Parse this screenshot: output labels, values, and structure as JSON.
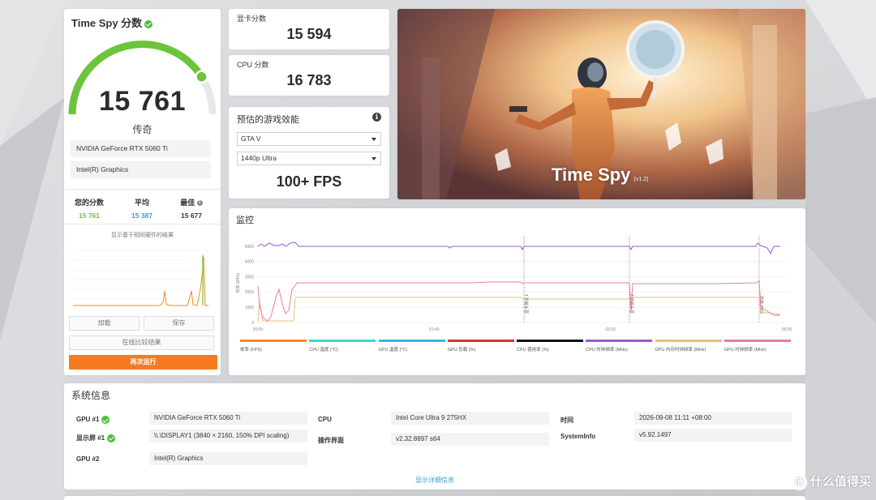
{
  "score_card": {
    "title": "Time Spy 分数",
    "score": "15 761",
    "gauge_fraction": 0.82,
    "rank": "传奇",
    "hardware": [
      "NVIDIA GeForce RTX 5060 Ti",
      "Intel(R) Graphics"
    ],
    "compare": {
      "your_label": "您的分数",
      "your_value": "15 761",
      "avg_label": "平均",
      "avg_value": "15 387",
      "best_label": "最佳",
      "best_value": "15 677"
    },
    "hist_caption": "显示基于相同硬件的结果",
    "hist_ticks": [
      "0",
      "2500",
      "5000",
      "7500",
      "10000",
      "12500",
      "15000"
    ],
    "load_button": "加载",
    "save_button": "保存",
    "compare_online": "在线比较结果",
    "run_again": "再次运行"
  },
  "gpu_score": {
    "label": "显卡分数",
    "value": "15 594"
  },
  "cpu_score": {
    "label": "CPU 分数",
    "value": "16 783"
  },
  "game_perf": {
    "title": "预估的游戏效能",
    "info": "i",
    "game": "GTA V",
    "preset": "1440p Ultra",
    "fps": "100+ FPS"
  },
  "banner": {
    "title": "Time Spy",
    "version": "(v1.2)"
  },
  "monitor": {
    "title": "监控",
    "y_axis_label": "频率 (MHz)",
    "y_ticks": [
      "0",
      "1000",
      "2000",
      "3000",
      "4000",
      "5000"
    ],
    "x_ticks": [
      "00:00",
      "01:40",
      "03:20",
      "05:00"
    ],
    "markers": [
      "显卡测试 1",
      "显卡测试 2",
      "CPU 测试"
    ],
    "legend": [
      {
        "label": "帧率 (FPS)",
        "color": "#f28a1c"
      },
      {
        "label": "CPU 温度 (°C)",
        "color": "#39dcc4"
      },
      {
        "label": "GPU 温度 (°C)",
        "color": "#34b6e6"
      },
      {
        "label": "GPU 负载 (%)",
        "color": "#e0312f"
      },
      {
        "label": "CPU 使用率 (%)",
        "color": "#111111"
      },
      {
        "label": "CPU 时钟频率 (MHz)",
        "color": "#9a5bd1"
      },
      {
        "label": "GPU 内存时钟频率 (MHz)",
        "color": "#e6c07c"
      },
      {
        "label": "GPU 时钟频率 (MHz)",
        "color": "#ea7ba6"
      }
    ]
  },
  "system_info": {
    "title": "系统信息",
    "gpu1_label": "GPU #1",
    "gpu1_value": "NVIDIA GeForce RTX 5060 Ti",
    "display1_label": "显示屏 #1",
    "display1_value": "\\\\.\\DISPLAY1 (3840 × 2160, 150% DPI scaling)",
    "gpu2_label": "GPU #2",
    "gpu2_value": "Intel(R) Graphics",
    "cpu_label": "CPU",
    "cpu_value": "Intel Core Ultra 9 275HX",
    "ui_label": "操作界面",
    "ui_value": "v2.32.8897 s64",
    "time_label": "时间",
    "time_value": "2026-09-08 11:11 +08:00",
    "sysinfo_label": "SystemInfo",
    "sysinfo_value": "v5.92.1497",
    "details_link": "显示详细信息"
  },
  "watermark": {
    "icon": "值",
    "text": "什么值得买"
  },
  "colors": {
    "accent_green": "#6cc43a",
    "accent_orange": "#f47b20",
    "avg_blue": "#3a9cd8"
  }
}
